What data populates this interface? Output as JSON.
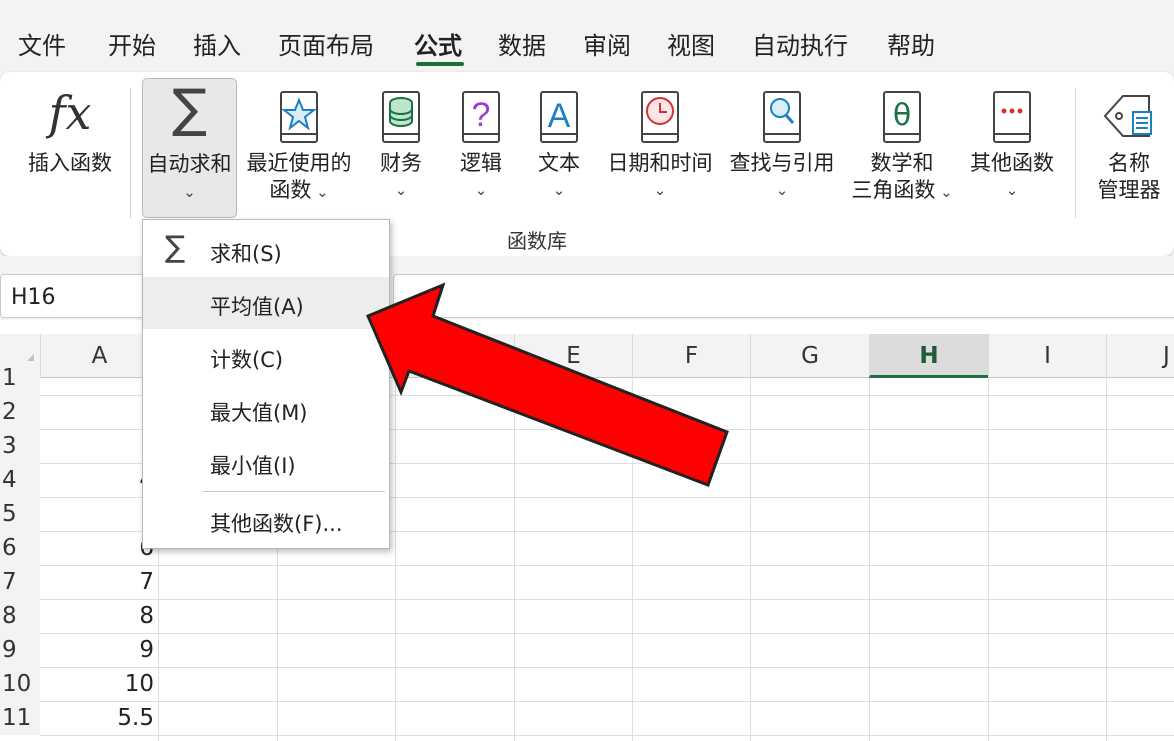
{
  "menu": {
    "tabs": [
      "文件",
      "开始",
      "插入",
      "页面布局",
      "公式",
      "数据",
      "审阅",
      "视图",
      "自动执行",
      "帮助"
    ],
    "active": "公式"
  },
  "ribbon": {
    "insert_function": "插入函数",
    "autosum": "自动求和",
    "recent": [
      "最近使用的",
      "函数"
    ],
    "financial": "财务",
    "logical": "逻辑",
    "text": "文本",
    "datetime": "日期和时间",
    "lookup": "查找与引用",
    "math": [
      "数学和",
      "三角函数"
    ],
    "more": "其他函数",
    "name_manager": [
      "名称",
      "管理器"
    ],
    "group_label": "函数库",
    "icon_fx": "fx",
    "icon_sigma": "∑",
    "icon_logic": "?",
    "icon_text": "A",
    "icon_math": "θ",
    "icon_more": "···"
  },
  "name_box": {
    "value": "H16"
  },
  "grid": {
    "columns": [
      "A",
      "E",
      "F",
      "G",
      "H",
      "I",
      "J"
    ],
    "active_column": "H",
    "rows": [
      "1",
      "2",
      "3",
      "4",
      "5",
      "6",
      "7",
      "8",
      "9",
      "10",
      "11"
    ],
    "col_a_values": [
      "",
      "",
      "",
      "4",
      "",
      "6",
      "7",
      "8",
      "9",
      "10",
      "5.5"
    ]
  },
  "dropdown": {
    "sigma": "∑",
    "items": [
      "求和(S)",
      "平均值(A)",
      "计数(C)",
      "最大值(M)",
      "最小值(I)",
      "其他函数(F)..."
    ],
    "highlighted": "平均值(A)"
  },
  "colors": {
    "accent": "#1e7145",
    "arrow_fill": "#ff0000",
    "arrow_stroke": "#222222"
  }
}
